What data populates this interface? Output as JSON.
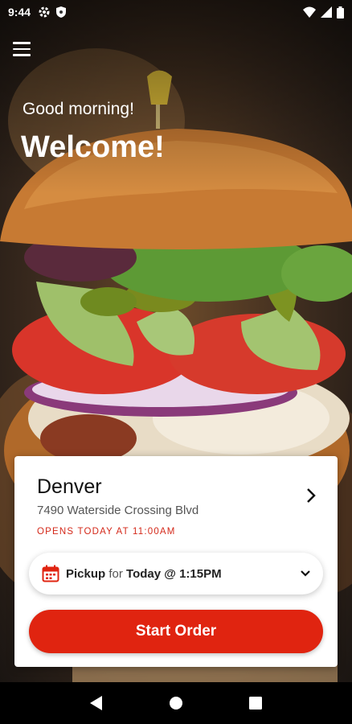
{
  "status_bar": {
    "time": "9:44"
  },
  "hero": {
    "greeting": "Good morning!",
    "title": "Welcome!"
  },
  "location": {
    "name": "Denver",
    "address": "7490 Waterside Crossing Blvd",
    "hours": "OPENS TODAY AT 11:00AM"
  },
  "pickup": {
    "mode": "Pickup",
    "connector": "for",
    "when": "Today @ 1:15PM"
  },
  "actions": {
    "start_order": "Start Order"
  },
  "colors": {
    "accent": "#e02410",
    "hours_text": "#d4291a"
  },
  "icons": {
    "menu": "hamburger-menu-icon",
    "location_chevron": "chevron-right-icon",
    "calendar": "calendar-icon",
    "dropdown": "chevron-down-icon",
    "nav_back": "back-triangle-icon",
    "nav_home": "home-circle-icon",
    "nav_recents": "recents-square-icon"
  }
}
